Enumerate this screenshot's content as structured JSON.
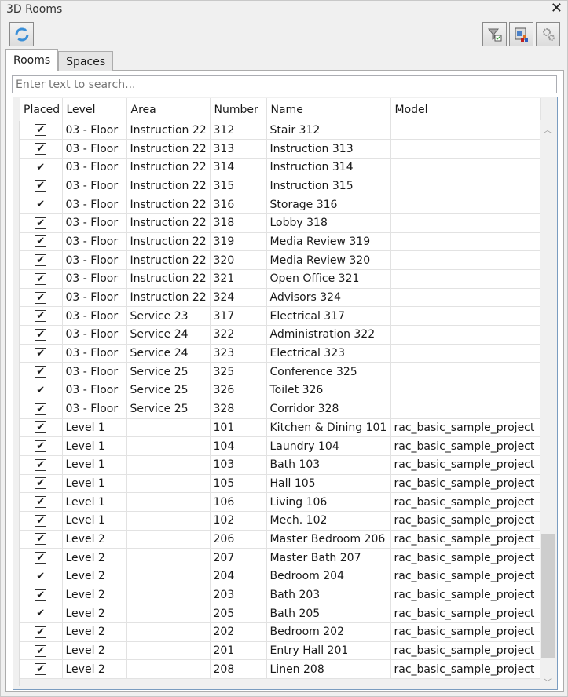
{
  "window": {
    "title": "3D Rooms",
    "close": "✕"
  },
  "toolbar": {
    "refresh_icon": "refresh-icon",
    "filter_icon": "filter-check-icon",
    "color_icon": "color-scheme-icon",
    "settings_icon": "gears-icon"
  },
  "tabs": [
    {
      "label": "Rooms",
      "active": true
    },
    {
      "label": "Spaces",
      "active": false
    }
  ],
  "search": {
    "placeholder": "Enter text to search...",
    "value": ""
  },
  "columns": [
    "Placed",
    "Level",
    "Area",
    "Number",
    "Name",
    "Model"
  ],
  "rows": [
    [
      "03 - Floor",
      "Instruction 22",
      "312",
      "Stair 312",
      ""
    ],
    [
      "03 - Floor",
      "Instruction 22",
      "313",
      "Instruction 313",
      ""
    ],
    [
      "03 - Floor",
      "Instruction 22",
      "314",
      "Instruction 314",
      ""
    ],
    [
      "03 - Floor",
      "Instruction 22",
      "315",
      "Instruction 315",
      ""
    ],
    [
      "03 - Floor",
      "Instruction 22",
      "316",
      "Storage 316",
      ""
    ],
    [
      "03 - Floor",
      "Instruction 22",
      "318",
      "Lobby 318",
      ""
    ],
    [
      "03 - Floor",
      "Instruction 22",
      "319",
      "Media Review 319",
      ""
    ],
    [
      "03 - Floor",
      "Instruction 22",
      "320",
      "Media Review 320",
      ""
    ],
    [
      "03 - Floor",
      "Instruction 22",
      "321",
      "Open Office 321",
      ""
    ],
    [
      "03 - Floor",
      "Instruction 22",
      "324",
      "Advisors 324",
      ""
    ],
    [
      "03 - Floor",
      "Service 23",
      "317",
      "Electrical 317",
      ""
    ],
    [
      "03 - Floor",
      "Service 24",
      "322",
      "Administration 322",
      ""
    ],
    [
      "03 - Floor",
      "Service 24",
      "323",
      "Electrical 323",
      ""
    ],
    [
      "03 - Floor",
      "Service 25",
      "325",
      "Conference 325",
      ""
    ],
    [
      "03 - Floor",
      "Service 25",
      "326",
      "Toilet 326",
      ""
    ],
    [
      "03 - Floor",
      "Service 25",
      "328",
      "Corridor 328",
      ""
    ],
    [
      "Level 1",
      "",
      "101",
      "Kitchen & Dining 101",
      "rac_basic_sample_project"
    ],
    [
      "Level 1",
      "",
      "104",
      "Laundry 104",
      "rac_basic_sample_project"
    ],
    [
      "Level 1",
      "",
      "103",
      "Bath 103",
      "rac_basic_sample_project"
    ],
    [
      "Level 1",
      "",
      "105",
      "Hall 105",
      "rac_basic_sample_project"
    ],
    [
      "Level 1",
      "",
      "106",
      "Living 106",
      "rac_basic_sample_project"
    ],
    [
      "Level 1",
      "",
      "102",
      "Mech. 102",
      "rac_basic_sample_project"
    ],
    [
      "Level 2",
      "",
      "206",
      "Master Bedroom 206",
      "rac_basic_sample_project"
    ],
    [
      "Level 2",
      "",
      "207",
      "Master Bath 207",
      "rac_basic_sample_project"
    ],
    [
      "Level 2",
      "",
      "204",
      "Bedroom 204",
      "rac_basic_sample_project"
    ],
    [
      "Level 2",
      "",
      "203",
      "Bath 203",
      "rac_basic_sample_project"
    ],
    [
      "Level 2",
      "",
      "205",
      "Bath 205",
      "rac_basic_sample_project"
    ],
    [
      "Level 2",
      "",
      "202",
      "Bedroom 202",
      "rac_basic_sample_project"
    ],
    [
      "Level 2",
      "",
      "201",
      "Entry Hall 201",
      "rac_basic_sample_project"
    ],
    [
      "Level 2",
      "",
      "208",
      "Linen 208",
      "rac_basic_sample_project"
    ]
  ],
  "placed_mark": "✔",
  "scroll": {
    "position_fraction": 0.78
  }
}
